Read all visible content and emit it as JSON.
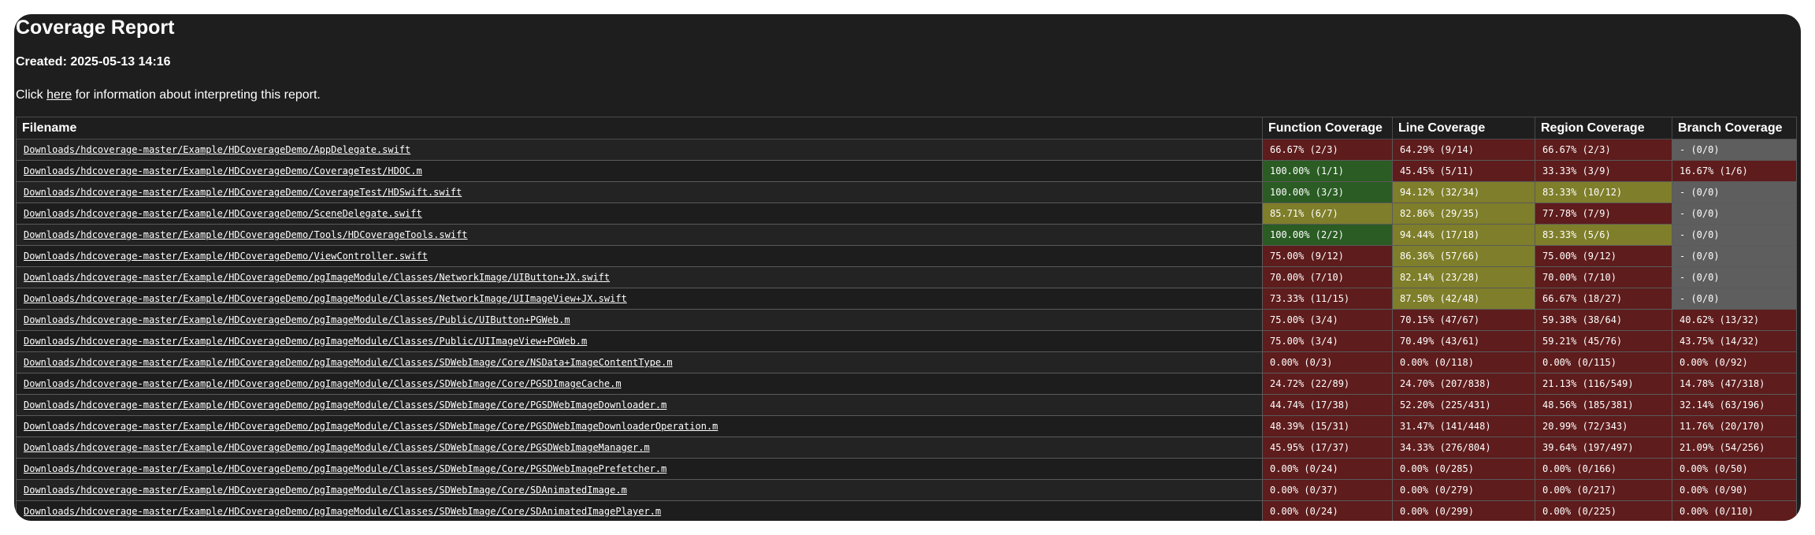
{
  "header": {
    "title": "Coverage Report",
    "created": "Created: 2025-05-13 14:16",
    "info_prefix": "Click ",
    "info_link": "here",
    "info_suffix": " for information about interpreting this report."
  },
  "columns": [
    "Filename",
    "Function Coverage",
    "Line Coverage",
    "Region Coverage",
    "Branch Coverage"
  ],
  "status_colors": {
    "red": "#5e1c1c",
    "yellow": "#7f7e2a",
    "green": "#2a5c23",
    "gray": "#5e5e5e"
  },
  "rows": [
    {
      "file": "Downloads/hdcoverage-master/Example/HDCoverageDemo/AppDelegate.swift",
      "cells": [
        {
          "text": "66.67% (2/3)",
          "level": "red"
        },
        {
          "text": "64.29% (9/14)",
          "level": "red"
        },
        {
          "text": "66.67% (2/3)",
          "level": "red"
        },
        {
          "text": "- (0/0)",
          "level": "gray"
        }
      ]
    },
    {
      "file": "Downloads/hdcoverage-master/Example/HDCoverageDemo/CoverageTest/HDOC.m",
      "cells": [
        {
          "text": "100.00% (1/1)",
          "level": "green"
        },
        {
          "text": "45.45% (5/11)",
          "level": "red"
        },
        {
          "text": "33.33% (3/9)",
          "level": "red"
        },
        {
          "text": "16.67% (1/6)",
          "level": "red"
        }
      ]
    },
    {
      "file": "Downloads/hdcoverage-master/Example/HDCoverageDemo/CoverageTest/HDSwift.swift",
      "cells": [
        {
          "text": "100.00% (3/3)",
          "level": "green"
        },
        {
          "text": "94.12% (32/34)",
          "level": "yellow"
        },
        {
          "text": "83.33% (10/12)",
          "level": "yellow"
        },
        {
          "text": "- (0/0)",
          "level": "gray"
        }
      ]
    },
    {
      "file": "Downloads/hdcoverage-master/Example/HDCoverageDemo/SceneDelegate.swift",
      "cells": [
        {
          "text": "85.71% (6/7)",
          "level": "yellow"
        },
        {
          "text": "82.86% (29/35)",
          "level": "yellow"
        },
        {
          "text": "77.78% (7/9)",
          "level": "red"
        },
        {
          "text": "- (0/0)",
          "level": "gray"
        }
      ]
    },
    {
      "file": "Downloads/hdcoverage-master/Example/HDCoverageDemo/Tools/HDCoverageTools.swift",
      "cells": [
        {
          "text": "100.00% (2/2)",
          "level": "green"
        },
        {
          "text": "94.44% (17/18)",
          "level": "yellow"
        },
        {
          "text": "83.33% (5/6)",
          "level": "yellow"
        },
        {
          "text": "- (0/0)",
          "level": "gray"
        }
      ]
    },
    {
      "file": "Downloads/hdcoverage-master/Example/HDCoverageDemo/ViewController.swift",
      "cells": [
        {
          "text": "75.00% (9/12)",
          "level": "red"
        },
        {
          "text": "86.36% (57/66)",
          "level": "yellow"
        },
        {
          "text": "75.00% (9/12)",
          "level": "red"
        },
        {
          "text": "- (0/0)",
          "level": "gray"
        }
      ]
    },
    {
      "file": "Downloads/hdcoverage-master/Example/HDCoverageDemo/pgImageModule/Classes/NetworkImage/UIButton+JX.swift",
      "cells": [
        {
          "text": "70.00% (7/10)",
          "level": "red"
        },
        {
          "text": "82.14% (23/28)",
          "level": "yellow"
        },
        {
          "text": "70.00% (7/10)",
          "level": "red"
        },
        {
          "text": "- (0/0)",
          "level": "gray"
        }
      ]
    },
    {
      "file": "Downloads/hdcoverage-master/Example/HDCoverageDemo/pgImageModule/Classes/NetworkImage/UIImageView+JX.swift",
      "cells": [
        {
          "text": "73.33% (11/15)",
          "level": "red"
        },
        {
          "text": "87.50% (42/48)",
          "level": "yellow"
        },
        {
          "text": "66.67% (18/27)",
          "level": "red"
        },
        {
          "text": "- (0/0)",
          "level": "gray"
        }
      ]
    },
    {
      "file": "Downloads/hdcoverage-master/Example/HDCoverageDemo/pgImageModule/Classes/Public/UIButton+PGWeb.m",
      "cells": [
        {
          "text": "75.00% (3/4)",
          "level": "red"
        },
        {
          "text": "70.15% (47/67)",
          "level": "red"
        },
        {
          "text": "59.38% (38/64)",
          "level": "red"
        },
        {
          "text": "40.62% (13/32)",
          "level": "red"
        }
      ]
    },
    {
      "file": "Downloads/hdcoverage-master/Example/HDCoverageDemo/pgImageModule/Classes/Public/UIImageView+PGWeb.m",
      "cells": [
        {
          "text": "75.00% (3/4)",
          "level": "red"
        },
        {
          "text": "70.49% (43/61)",
          "level": "red"
        },
        {
          "text": "59.21% (45/76)",
          "level": "red"
        },
        {
          "text": "43.75% (14/32)",
          "level": "red"
        }
      ]
    },
    {
      "file": "Downloads/hdcoverage-master/Example/HDCoverageDemo/pgImageModule/Classes/SDWebImage/Core/NSData+ImageContentType.m",
      "cells": [
        {
          "text": "0.00% (0/3)",
          "level": "red"
        },
        {
          "text": "0.00% (0/118)",
          "level": "red"
        },
        {
          "text": "0.00% (0/115)",
          "level": "red"
        },
        {
          "text": "0.00% (0/92)",
          "level": "red"
        }
      ]
    },
    {
      "file": "Downloads/hdcoverage-master/Example/HDCoverageDemo/pgImageModule/Classes/SDWebImage/Core/PGSDImageCache.m",
      "cells": [
        {
          "text": "24.72% (22/89)",
          "level": "red"
        },
        {
          "text": "24.70% (207/838)",
          "level": "red"
        },
        {
          "text": "21.13% (116/549)",
          "level": "red"
        },
        {
          "text": "14.78% (47/318)",
          "level": "red"
        }
      ]
    },
    {
      "file": "Downloads/hdcoverage-master/Example/HDCoverageDemo/pgImageModule/Classes/SDWebImage/Core/PGSDWebImageDownloader.m",
      "cells": [
        {
          "text": "44.74% (17/38)",
          "level": "red"
        },
        {
          "text": "52.20% (225/431)",
          "level": "red"
        },
        {
          "text": "48.56% (185/381)",
          "level": "red"
        },
        {
          "text": "32.14% (63/196)",
          "level": "red"
        }
      ]
    },
    {
      "file": "Downloads/hdcoverage-master/Example/HDCoverageDemo/pgImageModule/Classes/SDWebImage/Core/PGSDWebImageDownloaderOperation.m",
      "cells": [
        {
          "text": "48.39% (15/31)",
          "level": "red"
        },
        {
          "text": "31.47% (141/448)",
          "level": "red"
        },
        {
          "text": "20.99% (72/343)",
          "level": "red"
        },
        {
          "text": "11.76% (20/170)",
          "level": "red"
        }
      ]
    },
    {
      "file": "Downloads/hdcoverage-master/Example/HDCoverageDemo/pgImageModule/Classes/SDWebImage/Core/PGSDWebImageManager.m",
      "cells": [
        {
          "text": "45.95% (17/37)",
          "level": "red"
        },
        {
          "text": "34.33% (276/804)",
          "level": "red"
        },
        {
          "text": "39.64% (197/497)",
          "level": "red"
        },
        {
          "text": "21.09% (54/256)",
          "level": "red"
        }
      ]
    },
    {
      "file": "Downloads/hdcoverage-master/Example/HDCoverageDemo/pgImageModule/Classes/SDWebImage/Core/PGSDWebImagePrefetcher.m",
      "cells": [
        {
          "text": "0.00% (0/24)",
          "level": "red"
        },
        {
          "text": "0.00% (0/285)",
          "level": "red"
        },
        {
          "text": "0.00% (0/166)",
          "level": "red"
        },
        {
          "text": "0.00% (0/50)",
          "level": "red"
        }
      ]
    },
    {
      "file": "Downloads/hdcoverage-master/Example/HDCoverageDemo/pgImageModule/Classes/SDWebImage/Core/SDAnimatedImage.m",
      "cells": [
        {
          "text": "0.00% (0/37)",
          "level": "red"
        },
        {
          "text": "0.00% (0/279)",
          "level": "red"
        },
        {
          "text": "0.00% (0/217)",
          "level": "red"
        },
        {
          "text": "0.00% (0/90)",
          "level": "red"
        }
      ]
    },
    {
      "file": "Downloads/hdcoverage-master/Example/HDCoverageDemo/pgImageModule/Classes/SDWebImage/Core/SDAnimatedImagePlayer.m",
      "cells": [
        {
          "text": "0.00% (0/24)",
          "level": "red"
        },
        {
          "text": "0.00% (0/299)",
          "level": "red"
        },
        {
          "text": "0.00% (0/225)",
          "level": "red"
        },
        {
          "text": "0.00% (0/110)",
          "level": "red"
        }
      ]
    }
  ]
}
